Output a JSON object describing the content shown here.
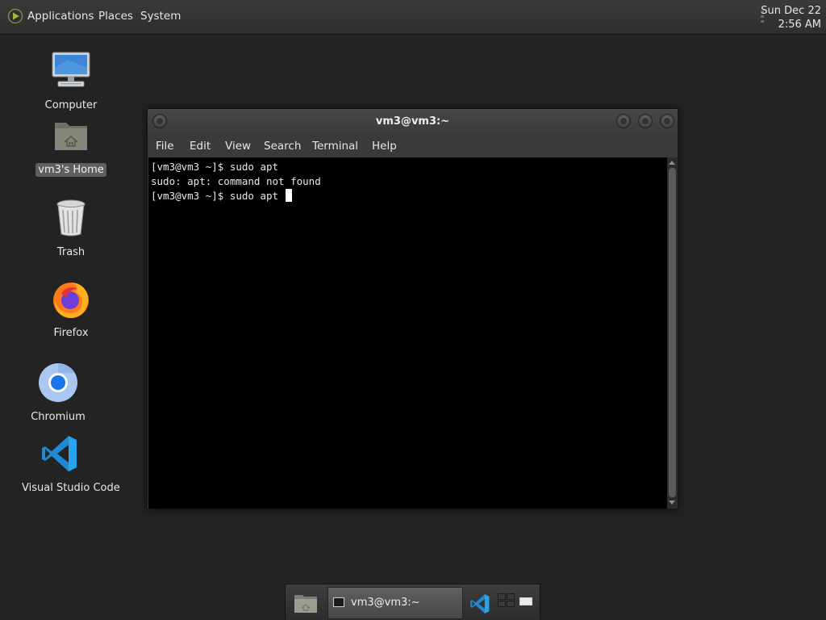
{
  "top_panel": {
    "menu": [
      "Applications",
      "Places",
      "System"
    ],
    "clock": {
      "date": "Sun Dec 22",
      "time": "2:56 AM"
    }
  },
  "desktop_icons": [
    {
      "label": "Computer",
      "icon": "computer-icon"
    },
    {
      "label": "vm3's Home",
      "icon": "home-folder-icon",
      "selected": true
    },
    {
      "label": "Trash",
      "icon": "trash-icon"
    },
    {
      "label": "Firefox",
      "icon": "firefox-icon"
    },
    {
      "label": "Chromium",
      "icon": "chromium-icon"
    },
    {
      "label": "Visual Studio Code",
      "icon": "vscode-icon"
    }
  ],
  "terminal": {
    "title": "vm3@vm3:~",
    "menu": [
      "File",
      "Edit",
      "View",
      "Search",
      "Terminal",
      "Help"
    ],
    "lines": [
      "[vm3@vm3 ~]$ sudo apt",
      "sudo: apt: command not found",
      "[vm3@vm3 ~]$ sudo apt "
    ]
  },
  "taskbar": {
    "tasks": [
      {
        "label": "vm3@vm3:~",
        "icon": "terminal-icon"
      }
    ]
  },
  "colors": {
    "desktop_bg": "#232323",
    "panel_bg": "#343434",
    "terminal_bg": "#000000",
    "terminal_fg": "#e8e8e8"
  }
}
